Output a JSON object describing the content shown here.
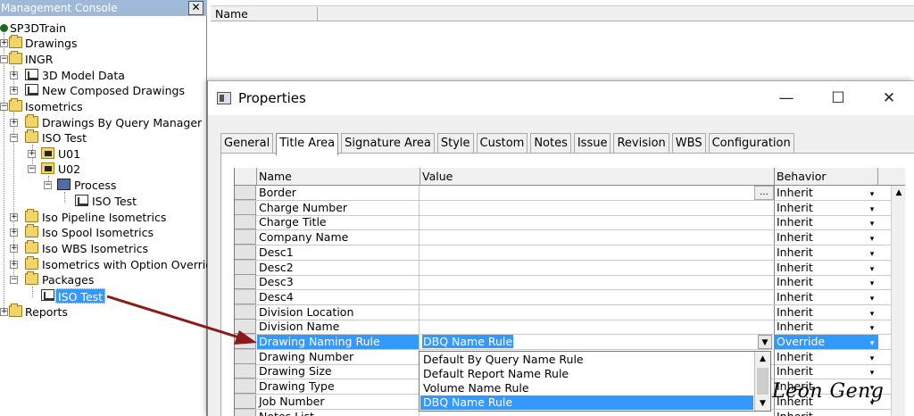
{
  "tree": {
    "title": "Management Console",
    "close_icon": "close-icon",
    "nodes": [
      {
        "label": "SP3DTrain",
        "icon": "globe-icon"
      },
      {
        "label": "Drawings",
        "icon": "folder-icon"
      },
      {
        "label": "INGR",
        "icon": "folder-icon"
      },
      {
        "label": "3D Model Data",
        "icon": "model-data-icon"
      },
      {
        "label": "New Composed Drawings",
        "icon": "composed-drawing-icon"
      },
      {
        "label": "Isometrics",
        "icon": "folder-icon"
      },
      {
        "label": "Drawings By Query Manager",
        "icon": "query-folder-icon"
      },
      {
        "label": "ISO Test",
        "icon": "query-folder-icon"
      },
      {
        "label": "U01",
        "icon": "plan-folder-icon"
      },
      {
        "label": "U02",
        "icon": "plan-folder-icon"
      },
      {
        "label": "Process",
        "icon": "process-icon"
      },
      {
        "label": "ISO Test",
        "icon": "iso-drawing-icon"
      },
      {
        "label": "Iso Pipeline Isometrics",
        "icon": "query-folder-icon"
      },
      {
        "label": "Iso Spool Isometrics",
        "icon": "query-folder-icon"
      },
      {
        "label": "Iso WBS Isometrics",
        "icon": "query-folder-icon"
      },
      {
        "label": "Isometrics with Option Override",
        "icon": "query-folder-icon"
      },
      {
        "label": "Packages",
        "icon": "folder-icon"
      },
      {
        "label": "ISO Test",
        "icon": "iso-drawing-icon"
      },
      {
        "label": "Reports",
        "icon": "folder-icon"
      }
    ]
  },
  "list": {
    "column_name": "Name"
  },
  "dialog": {
    "title": "Properties",
    "minimize": "—",
    "maximize": "☐",
    "close": "✕",
    "tabs": [
      "General",
      "Title Area",
      "Signature Area",
      "Style",
      "Custom",
      "Notes",
      "Issue",
      "Revision",
      "WBS",
      "Configuration"
    ],
    "active_tab": "Title Area",
    "grid": {
      "headers": {
        "name": "Name",
        "value": "Value",
        "behavior": "Behavior"
      },
      "rows": [
        {
          "name": "Border",
          "value": "",
          "behavior": "Inherit"
        },
        {
          "name": "Charge Number",
          "value": "",
          "behavior": "Inherit"
        },
        {
          "name": "Charge Title",
          "value": "",
          "behavior": "Inherit"
        },
        {
          "name": "Company Name",
          "value": "",
          "behavior": "Inherit"
        },
        {
          "name": "Desc1",
          "value": "",
          "behavior": "Inherit"
        },
        {
          "name": "Desc2",
          "value": "",
          "behavior": "Inherit"
        },
        {
          "name": "Desc3",
          "value": "",
          "behavior": "Inherit"
        },
        {
          "name": "Desc4",
          "value": "",
          "behavior": "Inherit"
        },
        {
          "name": "Division Location",
          "value": "",
          "behavior": "Inherit"
        },
        {
          "name": "Division Name",
          "value": "",
          "behavior": "Inherit"
        },
        {
          "name": "Drawing Naming Rule",
          "value": "DBQ Name Rule",
          "behavior": "Override"
        },
        {
          "name": "Drawing Number",
          "value": "",
          "behavior": "Inherit"
        },
        {
          "name": "Drawing Size",
          "value": "",
          "behavior": "Inherit"
        },
        {
          "name": "Drawing Type",
          "value": "",
          "behavior": "Inherit"
        },
        {
          "name": "Job Number",
          "value": "",
          "behavior": "Inherit"
        },
        {
          "name": "Notes List",
          "value": "",
          "behavior": "Inherit"
        }
      ],
      "ellipsis": "..."
    },
    "dropdown": {
      "options": [
        "Default By Query Name Rule",
        "Default Report Name Rule",
        "Volume Name Rule",
        "DBQ Name Rule"
      ],
      "selected": "DBQ Name Rule"
    }
  },
  "watermark": "Leon Geng",
  "colors": {
    "selection": "#3399ff",
    "arrow": "#8b1a1a",
    "tree_title": "#9fb9d8"
  }
}
